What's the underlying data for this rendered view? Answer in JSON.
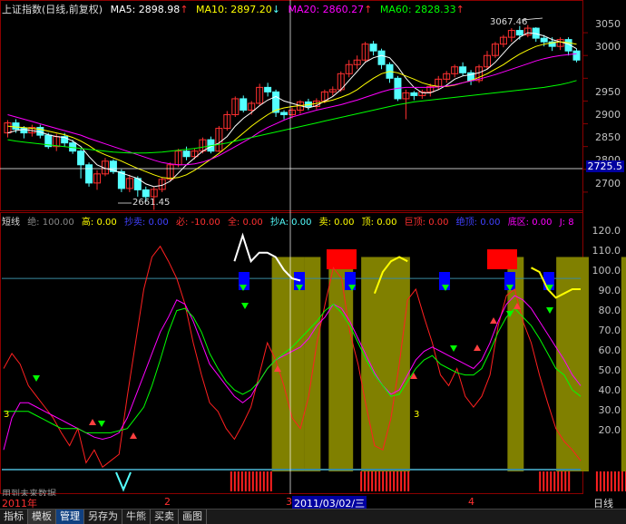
{
  "main_header": {
    "title": "上证指数(日线,前复权)",
    "ma5": "MA5: 2898.98",
    "ma10": "MA10: 2897.20",
    "ma20": "MA20: 2860.27",
    "ma60": "MA60: 2828.33",
    "ma5_arrow": "↑",
    "ma10_arrow": "↓",
    "ma20_arrow": "↑",
    "ma60_arrow": "↑"
  },
  "main_axis": [
    "3050",
    "3000",
    "2950",
    "2900",
    "2850",
    "2800",
    "2750",
    "2700"
  ],
  "crosshair_value": "2725.5",
  "high_label": "3067.46",
  "low_label": "2661.45",
  "ind_header": {
    "name": "短线",
    "jue": "绝: 100.00",
    "gao": "高: 0.00",
    "chaomai": "抄卖: 0.00",
    "bi": "必: -10.00",
    "quan": "全: 0.00",
    "chaoA": "抄A: 0.00",
    "mai": "卖: 0.00",
    "ding": "顶: 0.00",
    "juding": "巨顶: 0.00",
    "juedi": "绝顶: 0.00",
    "diqu": "底区: 0.00",
    "j": "J: 8"
  },
  "ind_axis": [
    "120.0",
    "110.0",
    "100.0",
    "90.0",
    "80.0",
    "70.0",
    "60.0",
    "50.0",
    "40.0",
    "30.0",
    "20.0"
  ],
  "ind_marker_left": "3",
  "ind_marker_mid": "3",
  "future_note": "用到未来数据",
  "date_labels": {
    "year": "2011年",
    "m2": "2",
    "m3": "3",
    "cursor_date": "2011/03/02/三",
    "m4": "4"
  },
  "period_label": "日线",
  "tabs": [
    "指标",
    "模板",
    "管理",
    "另存为",
    "牛熊",
    "买卖",
    "画图"
  ],
  "active_tab": "管理",
  "colors": {
    "up": "#ff3030",
    "down": "#54ffff",
    "ma5": "#ffffff",
    "ma10": "#ffff00",
    "ma20": "#ff00ff",
    "ma60": "#00ff00",
    "band": "#808000",
    "blue_box": "#0000ff",
    "red_box": "#ff0000",
    "ref_line": "#3a8aa0",
    "axis": "#c0c0c0"
  },
  "chart_data": [
    {
      "type": "candlestick",
      "title": "上证指数(日线,前复权)",
      "ylim": [
        2660,
        3090
      ],
      "note": "values are approximate daily [open, close, low, high] read from the chart",
      "candles": [
        [
          2830,
          2852,
          2820,
          2858
        ],
        [
          2852,
          2838,
          2830,
          2860
        ],
        [
          2840,
          2830,
          2818,
          2845
        ],
        [
          2830,
          2842,
          2822,
          2848
        ],
        [
          2842,
          2825,
          2818,
          2848
        ],
        [
          2825,
          2800,
          2795,
          2830
        ],
        [
          2800,
          2822,
          2790,
          2828
        ],
        [
          2822,
          2808,
          2800,
          2830
        ],
        [
          2808,
          2790,
          2784,
          2815
        ],
        [
          2790,
          2760,
          2730,
          2795
        ],
        [
          2760,
          2720,
          2712,
          2765
        ],
        [
          2720,
          2740,
          2705,
          2748
        ],
        [
          2740,
          2768,
          2735,
          2775
        ],
        [
          2768,
          2745,
          2740,
          2772
        ],
        [
          2745,
          2708,
          2700,
          2750
        ],
        [
          2708,
          2730,
          2700,
          2738
        ],
        [
          2730,
          2705,
          2690,
          2735
        ],
        [
          2705,
          2690,
          2680,
          2712
        ],
        [
          2690,
          2706,
          2661,
          2712
        ],
        [
          2706,
          2728,
          2700,
          2732
        ],
        [
          2728,
          2760,
          2725,
          2765
        ],
        [
          2760,
          2790,
          2755,
          2795
        ],
        [
          2790,
          2778,
          2770,
          2800
        ],
        [
          2778,
          2790,
          2772,
          2796
        ],
        [
          2790,
          2815,
          2785,
          2820
        ],
        [
          2815,
          2790,
          2785,
          2822
        ],
        [
          2790,
          2840,
          2788,
          2845
        ],
        [
          2840,
          2870,
          2835,
          2878
        ],
        [
          2870,
          2905,
          2865,
          2910
        ],
        [
          2905,
          2880,
          2875,
          2912
        ],
        [
          2880,
          2895,
          2870,
          2900
        ],
        [
          2895,
          2930,
          2890,
          2938
        ],
        [
          2930,
          2920,
          2910,
          2940
        ],
        [
          2920,
          2875,
          2865,
          2925
        ],
        [
          2875,
          2870,
          2860,
          2880
        ],
        [
          2870,
          2880,
          2862,
          2886
        ],
        [
          2880,
          2898,
          2872,
          2902
        ],
        [
          2898,
          2888,
          2880,
          2905
        ],
        [
          2888,
          2900,
          2882,
          2906
        ],
        [
          2900,
          2920,
          2895,
          2925
        ],
        [
          2920,
          2925,
          2912,
          2932
        ],
        [
          2925,
          2960,
          2920,
          2965
        ],
        [
          2960,
          2980,
          2952,
          2990
        ],
        [
          2980,
          2990,
          2970,
          3000
        ],
        [
          2990,
          3025,
          2985,
          3030
        ],
        [
          3025,
          3010,
          3000,
          3032
        ],
        [
          3010,
          2980,
          2970,
          3015
        ],
        [
          2980,
          2950,
          2940,
          2985
        ],
        [
          2950,
          2905,
          2900,
          2955
        ],
        [
          2905,
          2918,
          2860,
          2925
        ],
        [
          2918,
          2912,
          2902,
          2922
        ],
        [
          2912,
          2920,
          2905,
          2925
        ],
        [
          2920,
          2932,
          2910,
          2938
        ],
        [
          2932,
          2948,
          2925,
          2955
        ],
        [
          2948,
          2960,
          2940,
          2966
        ],
        [
          2960,
          2975,
          2952,
          2980
        ],
        [
          2975,
          2962,
          2955,
          2985
        ],
        [
          2962,
          2945,
          2935,
          2968
        ],
        [
          2945,
          2975,
          2940,
          2980
        ],
        [
          2975,
          3000,
          2970,
          3010
        ],
        [
          3000,
          3025,
          2995,
          3030
        ],
        [
          3025,
          3040,
          3018,
          3045
        ],
        [
          3040,
          3055,
          3030,
          3060
        ],
        [
          3055,
          3045,
          3035,
          3065
        ],
        [
          3045,
          3060,
          3040,
          3067
        ],
        [
          3060,
          3038,
          3030,
          3062
        ],
        [
          3038,
          3030,
          3020,
          3045
        ],
        [
          3030,
          3020,
          3010,
          3040
        ],
        [
          3020,
          3035,
          3012,
          3040
        ],
        [
          3035,
          3010,
          3000,
          3040
        ],
        [
          3010,
          2990,
          2985,
          3015
        ]
      ],
      "series": [
        {
          "name": "MA5",
          "values": [
            2830,
            2835,
            2838,
            2835,
            2832,
            2826,
            2822,
            2820,
            2812,
            2800,
            2778,
            2760,
            2752,
            2748,
            2742,
            2736,
            2730,
            2718,
            2712,
            2715,
            2724,
            2742,
            2760,
            2775,
            2790,
            2800,
            2808,
            2822,
            2845,
            2862,
            2875,
            2890,
            2902,
            2910,
            2900,
            2895,
            2890,
            2885,
            2890,
            2900,
            2910,
            2925,
            2945,
            2965,
            2985,
            2995,
            3000,
            2995,
            2975,
            2950,
            2930,
            2918,
            2918,
            2925,
            2935,
            2948,
            2955,
            2958,
            2962,
            2970,
            2985,
            3005,
            3025,
            3040,
            3050,
            3048,
            3043,
            3035,
            3030,
            3025,
            3015
          ]
        },
        {
          "name": "MA10",
          "values": [
            2845,
            2843,
            2842,
            2840,
            2838,
            2834,
            2830,
            2826,
            2820,
            2812,
            2802,
            2790,
            2782,
            2775,
            2768,
            2760,
            2752,
            2745,
            2738,
            2732,
            2730,
            2732,
            2738,
            2748,
            2760,
            2772,
            2785,
            2800,
            2815,
            2830,
            2845,
            2858,
            2870,
            2880,
            2885,
            2888,
            2890,
            2892,
            2895,
            2898,
            2902,
            2908,
            2915,
            2925,
            2938,
            2950,
            2960,
            2965,
            2962,
            2955,
            2948,
            2940,
            2935,
            2932,
            2932,
            2935,
            2940,
            2945,
            2952,
            2960,
            2970,
            2980,
            2992,
            3003,
            3012,
            3020,
            3025,
            3028,
            3030,
            3028,
            3025
          ]
        },
        {
          "name": "MA20",
          "values": [
            2870,
            2865,
            2860,
            2855,
            2850,
            2845,
            2840,
            2835,
            2830,
            2825,
            2818,
            2812,
            2806,
            2800,
            2794,
            2788,
            2782,
            2776,
            2770,
            2765,
            2762,
            2760,
            2760,
            2762,
            2766,
            2772,
            2780,
            2790,
            2800,
            2810,
            2820,
            2832,
            2842,
            2850,
            2858,
            2865,
            2870,
            2875,
            2880,
            2884,
            2888,
            2892,
            2897,
            2902,
            2908,
            2914,
            2920,
            2925,
            2928,
            2930,
            2930,
            2930,
            2930,
            2931,
            2933,
            2936,
            2940,
            2944,
            2948,
            2953,
            2958,
            2964,
            2970,
            2976,
            2982,
            2988,
            2993,
            2997,
            3000,
            3002,
            3004
          ]
        },
        {
          "name": "MA60",
          "values": [
            2815,
            2812,
            2810,
            2808,
            2806,
            2804,
            2802,
            2800,
            2798,
            2796,
            2794,
            2792,
            2790,
            2788,
            2787,
            2786,
            2786,
            2786,
            2787,
            2788,
            2790,
            2792,
            2794,
            2796,
            2799,
            2802,
            2805,
            2808,
            2812,
            2816,
            2820,
            2824,
            2828,
            2832,
            2836,
            2840,
            2844,
            2848,
            2852,
            2856,
            2860,
            2864,
            2868,
            2872,
            2876,
            2880,
            2884,
            2888,
            2892,
            2895,
            2898,
            2900,
            2902,
            2904,
            2906,
            2908,
            2910,
            2912,
            2914,
            2916,
            2918,
            2920,
            2922,
            2924,
            2926,
            2928,
            2930,
            2933,
            2936,
            2940,
            2945
          ]
        }
      ]
    },
    {
      "type": "line",
      "title": "短线",
      "ylim": [
        10,
        125
      ],
      "series": [
        {
          "name": "white",
          "values": [
            null,
            null,
            null,
            null,
            null,
            null,
            null,
            null,
            null,
            null,
            null,
            null,
            null,
            null,
            null,
            null,
            null,
            null,
            null,
            null,
            null,
            null,
            null,
            null,
            null,
            null,
            null,
            null,
            108,
            120,
            108,
            112,
            112,
            110,
            104,
            100,
            99,
            null,
            null,
            null,
            null,
            null,
            null,
            null,
            null,
            null,
            null,
            null,
            null,
            null,
            null,
            null,
            null,
            null,
            null,
            null,
            null,
            null,
            null,
            null,
            null,
            null,
            null,
            null,
            null,
            null,
            null,
            null,
            null,
            null,
            null
          ]
        },
        {
          "name": "yellow",
          "values": [
            null,
            null,
            null,
            null,
            null,
            null,
            null,
            null,
            null,
            null,
            null,
            null,
            null,
            null,
            null,
            null,
            null,
            null,
            null,
            null,
            null,
            null,
            null,
            null,
            null,
            null,
            null,
            null,
            null,
            null,
            null,
            null,
            null,
            null,
            null,
            null,
            null,
            null,
            null,
            null,
            null,
            null,
            null,
            null,
            null,
            93,
            103,
            108,
            110,
            108,
            null,
            null,
            null,
            null,
            null,
            null,
            null,
            null,
            null,
            null,
            null,
            null,
            null,
            null,
            105,
            103,
            95,
            91,
            93,
            95,
            95
          ]
        },
        {
          "name": "red",
          "values": [
            58,
            65,
            60,
            50,
            45,
            40,
            35,
            28,
            22,
            30,
            14,
            20,
            12,
            15,
            18,
            45,
            70,
            95,
            110,
            115,
            108,
            100,
            88,
            70,
            55,
            42,
            38,
            30,
            25,
            32,
            40,
            55,
            70,
            62,
            50,
            35,
            30,
            45,
            70,
            88,
            105,
            100,
            75,
            60,
            40,
            22,
            20,
            35,
            60,
            90,
            95,
            82,
            70,
            55,
            50,
            58,
            45,
            40,
            45,
            55,
            78,
            92,
            95,
            80,
            70,
            55,
            42,
            30,
            24,
            20,
            15
          ]
        },
        {
          "name": "magenta",
          "values": [
            20,
            35,
            42,
            42,
            40,
            38,
            36,
            34,
            32,
            30,
            28,
            26,
            25,
            26,
            28,
            35,
            45,
            55,
            65,
            75,
            82,
            90,
            88,
            80,
            70,
            60,
            55,
            50,
            45,
            42,
            45,
            52,
            58,
            62,
            64,
            66,
            68,
            72,
            78,
            82,
            88,
            86,
            80,
            72,
            64,
            56,
            50,
            46,
            48,
            55,
            62,
            66,
            68,
            66,
            64,
            62,
            60,
            58,
            62,
            70,
            80,
            88,
            92,
            90,
            86,
            80,
            74,
            68,
            62,
            55,
            50
          ]
        },
        {
          "name": "green",
          "values": [
            38,
            38,
            38,
            38,
            36,
            34,
            32,
            30,
            30,
            30,
            28,
            28,
            28,
            28,
            29,
            30,
            35,
            40,
            50,
            62,
            75,
            85,
            86,
            82,
            75,
            65,
            58,
            52,
            48,
            46,
            48,
            52,
            58,
            62,
            65,
            68,
            72,
            76,
            80,
            85,
            88,
            84,
            78,
            70,
            62,
            55,
            50,
            45,
            46,
            52,
            58,
            62,
            64,
            60,
            58,
            56,
            55,
            55,
            58,
            66,
            75,
            82,
            86,
            82,
            78,
            72,
            65,
            58,
            55,
            48,
            45
          ]
        }
      ]
    }
  ]
}
